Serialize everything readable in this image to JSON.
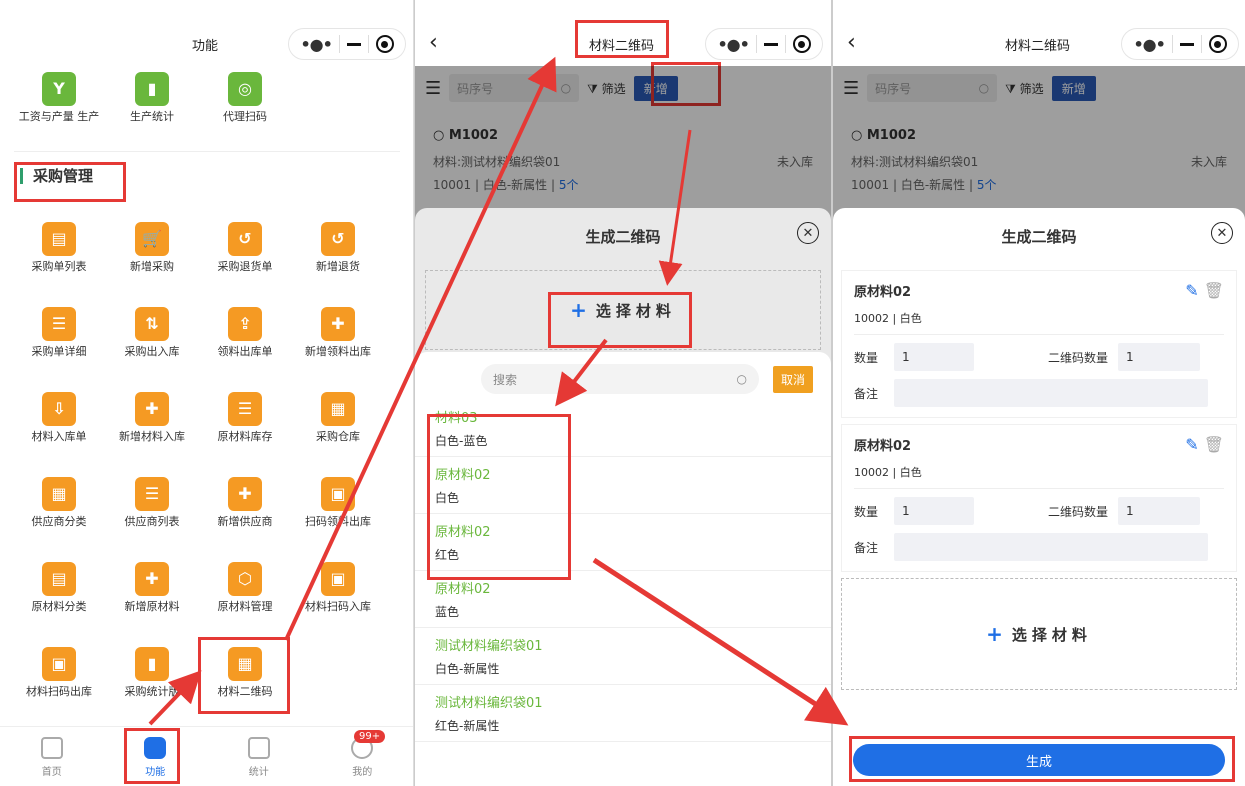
{
  "p1": {
    "title": "功能",
    "top_tiles": [
      {
        "label": "工资与产量 生产",
        "icon": "Y"
      },
      {
        "label": "生产统计",
        "icon": "▮"
      },
      {
        "label": "代理扫码",
        "icon": "◎"
      }
    ],
    "section": "采购管理",
    "tiles": [
      "采购单列表",
      "新增采购",
      "采购退货单",
      "新增退货",
      "采购单详细",
      "采购出入库",
      "领料出库单",
      "新增领料出库",
      "材料入库单",
      "新增材料入库",
      "原材料库存",
      "采购仓库",
      "供应商分类",
      "供应商列表",
      "新增供应商",
      "扫码领料出库",
      "原材料分类",
      "新增原材料",
      "原材料管理",
      "材料扫码入库",
      "材料扫码出库",
      "采购统计版",
      "材料二维码"
    ],
    "tabs": [
      "首页",
      "功能",
      "统计",
      "我的"
    ],
    "badge": "99+"
  },
  "p2": {
    "title": "材料二维码",
    "search_placeholder": "码序号",
    "filter": "筛选",
    "add": "新增",
    "card": {
      "code": "M1002",
      "material": "材料:测试材料编织袋01",
      "status": "未入库",
      "line2": "10001 | 白色-新属性 | ",
      "count": "5个"
    },
    "sheet_title": "生成二维码",
    "select": "选择材料",
    "search2": "搜索",
    "cancel": "取消",
    "items": [
      {
        "name": "材料03",
        "attr": "白色-蓝色"
      },
      {
        "name": "原材料02",
        "attr": "白色"
      },
      {
        "name": "原材料02",
        "attr": "红色"
      },
      {
        "name": "原材料02",
        "attr": "蓝色"
      },
      {
        "name": "测试材料编织袋01",
        "attr": "白色-新属性"
      },
      {
        "name": "测试材料编织袋01",
        "attr": "红色-新属性"
      }
    ]
  },
  "p3": {
    "title": "材料二维码",
    "search_placeholder": "码序号",
    "filter": "筛选",
    "add": "新增",
    "card": {
      "code": "M1002",
      "material": "材料:测试材料编织袋01",
      "status": "未入库",
      "line2": "10001 | 白色-新属性 | ",
      "count": "5个"
    },
    "sheet_title": "生成二维码",
    "select": "选择材料",
    "generate": "生成",
    "forms": [
      {
        "name": "原材料02",
        "sub": "10002 | 白色",
        "qty_label": "数量",
        "qty": "1",
        "qr_label": "二维码数量",
        "qr": "1",
        "note_label": "备注"
      },
      {
        "name": "原材料02",
        "sub": "10002 | 白色",
        "qty_label": "数量",
        "qty": "1",
        "qr_label": "二维码数量",
        "qr": "1",
        "note_label": "备注"
      }
    ]
  }
}
